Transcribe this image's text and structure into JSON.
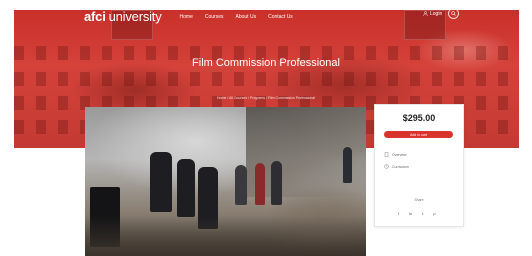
{
  "header": {
    "logo_bold": "afci",
    "logo_light": "university",
    "nav": [
      "Home",
      "Courses",
      "About Us",
      "Contact Us"
    ],
    "login_label": "Login"
  },
  "hero": {
    "title": "Film Commission Professional",
    "breadcrumb": "Home / All Courses / Programs / Film Commission Professional"
  },
  "course_card": {
    "price": "$295.00",
    "cta_label": "Add to cart",
    "options": [
      "Overview",
      "Curriculum"
    ],
    "share_label": "Share",
    "share_icons": [
      "f",
      "in",
      "t",
      "p"
    ]
  },
  "colors": {
    "accent": "#d8332c",
    "hero_tint": "#c9302a"
  }
}
